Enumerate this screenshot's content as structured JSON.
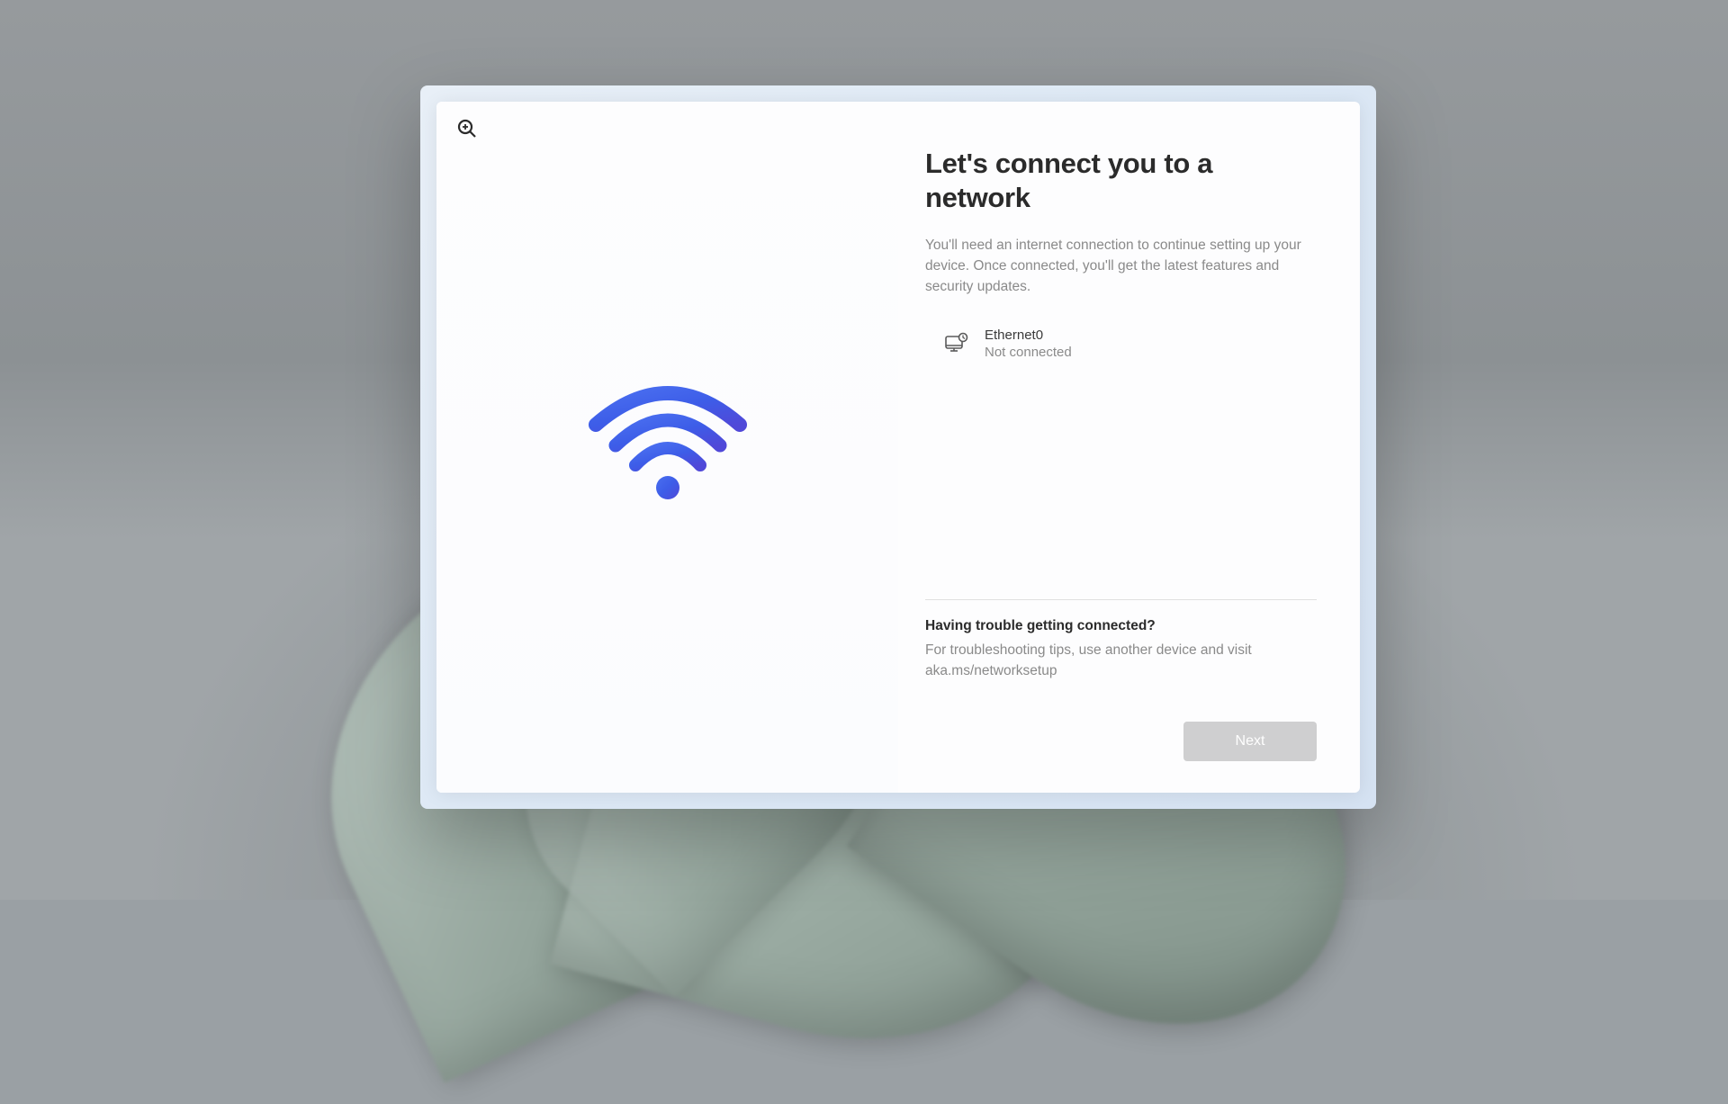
{
  "title": "Let's connect you to a network",
  "description": "You'll need an internet connection to continue setting up your device. Once connected, you'll get the latest features and security updates.",
  "network": {
    "name": "Ethernet0",
    "status": "Not connected"
  },
  "trouble": {
    "heading": "Having trouble getting connected?",
    "text": "For troubleshooting tips, use another device and visit aka.ms/networksetup"
  },
  "buttons": {
    "next": "Next"
  }
}
